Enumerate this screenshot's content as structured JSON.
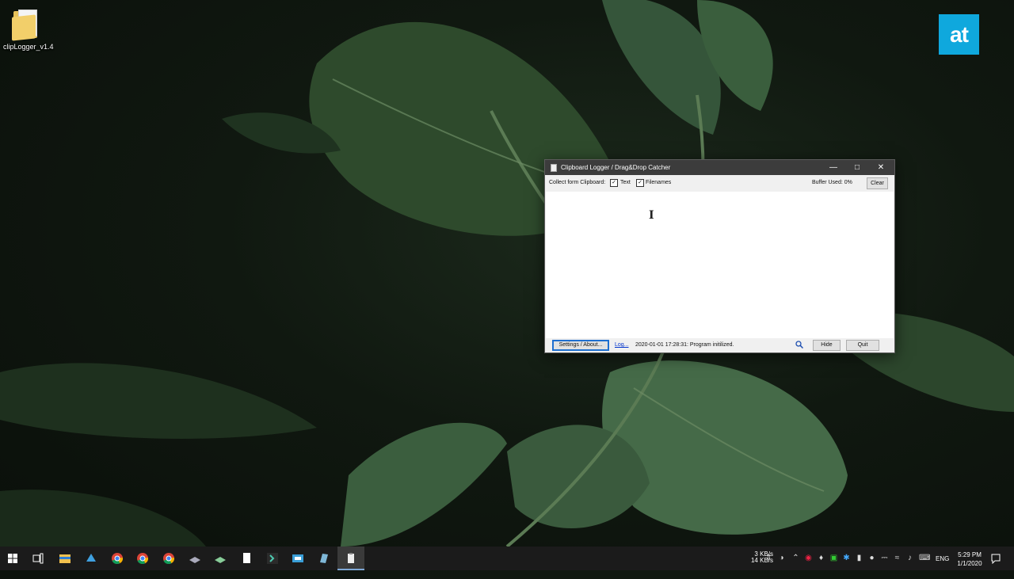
{
  "desktop": {
    "icon_label": "clipLogger_v1.4",
    "logo_text": "at"
  },
  "window": {
    "title": "Clipboard Logger / Drag&Drop Catcher",
    "toolbar": {
      "collect_label": "Collect form Clipboard:",
      "text_checkbox": {
        "label": "Text",
        "checked": true
      },
      "filenames_checkbox": {
        "label": "Filenames",
        "checked": true
      },
      "buffer_label": "Buffer Used: 0%",
      "clear_label": "Clear"
    },
    "textarea_value": "",
    "statusbar": {
      "settings_label": "Settings / About...",
      "log_label": "Log...",
      "status_text": "2020-01-01 17:28:31: Program initilized.",
      "hide_label": "Hide",
      "quit_label": "Quit"
    }
  },
  "taskbar": {
    "net_up": "3 KB/s",
    "net_down": "14 KB/s",
    "language": "ENG",
    "time": "5:29 PM",
    "date": "1/1/2020",
    "apps": [
      "start-icon",
      "task-view-icon",
      "file-explorer-icon",
      "app-icon",
      "chrome-icon",
      "chrome-icon",
      "chrome-icon",
      "app-icon",
      "app-icon",
      "notepad-icon",
      "terminal-icon",
      "app-icon",
      "app-icon",
      "clipboard-logger-icon"
    ]
  },
  "colors": {
    "titlebar": "#3c3c3c",
    "accent": "#0fa8dd",
    "taskbar": "#1b1b1b"
  }
}
